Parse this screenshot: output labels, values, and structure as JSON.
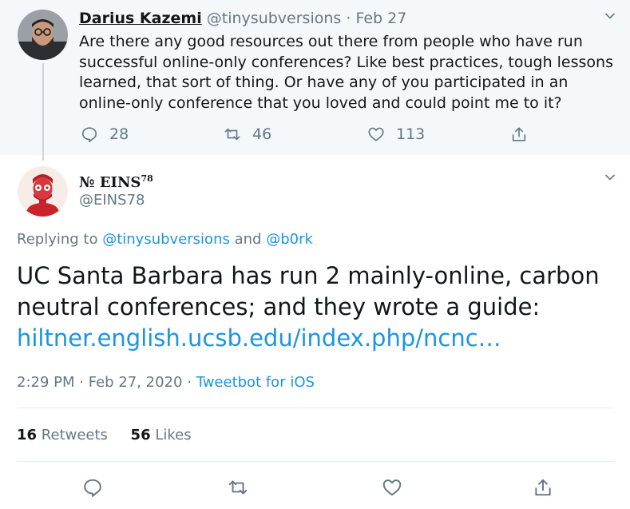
{
  "parent_tweet": {
    "display_name": "Darius Kazemi",
    "handle": "@tinysubversions",
    "separator": "·",
    "date": "Feb 27",
    "text": "Are there any good resources out there from people who have run successful online-only conferences? Like best practices, tough lessons learned, that sort of thing. Or have any of you participated in an online-only conference that you loved and could point me to it?",
    "reply_count": "28",
    "retweet_count": "46",
    "like_count": "113"
  },
  "main_tweet": {
    "display_name": "№ EINS",
    "name_superscript": "78",
    "handle": "@EINS78",
    "replying_prefix": "Replying to",
    "replying_user_1": "@tinysubversions",
    "replying_and": "and",
    "replying_user_2": "@b0rk",
    "text": "UC Santa Barbara has run 2 mainly-online, carbon neutral conferences; and they wrote a guide:",
    "link": "hiltner.english.ucsb.edu/index.php/ncnc…",
    "time": "2:29 PM",
    "date": "Feb 27, 2020",
    "separator": "·",
    "source": "Tweetbot for iOS",
    "retweets_count": "16",
    "retweets_label": "Retweets",
    "likes_count": "56",
    "likes_label": "Likes"
  },
  "colors": {
    "link": "#1b95e0",
    "muted": "#657786",
    "text": "#14171a",
    "parent_bg": "#f5f8fa",
    "border": "#e6ecf0"
  },
  "icons": [
    "chevron-down-icon",
    "reply-icon",
    "retweet-icon",
    "like-icon",
    "share-icon"
  ]
}
